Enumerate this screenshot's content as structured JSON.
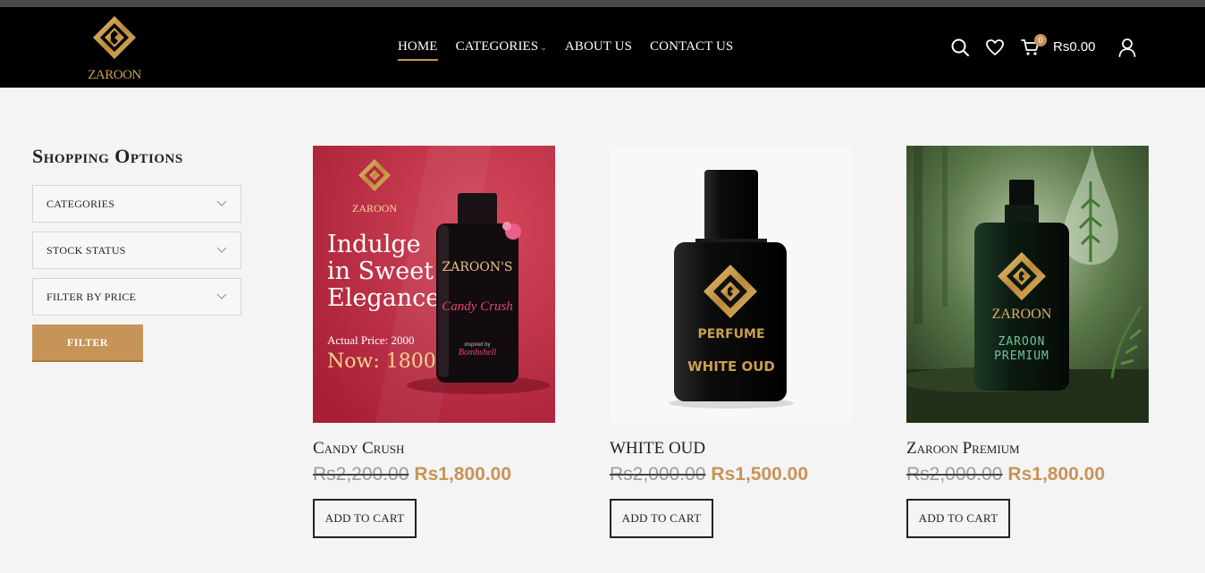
{
  "header": {
    "logo_text": "ZAROON",
    "nav": [
      {
        "label": "HOME"
      },
      {
        "label": "CATEGORIES"
      },
      {
        "label": "ABOUT US"
      },
      {
        "label": "CONTACT US"
      }
    ],
    "cart_count": "0",
    "cart_total": "Rs0.00",
    "icons": [
      "search-icon",
      "heart-icon",
      "cart-icon",
      "user-icon"
    ]
  },
  "sidebar": {
    "title": "Shopping Options",
    "filters": [
      {
        "label": "CATEGORIES"
      },
      {
        "label": "STOCK STATUS"
      },
      {
        "label": "FILTER BY PRICE"
      }
    ],
    "filter_button": "FILTER"
  },
  "products": [
    {
      "name": "Candy Crush",
      "old_price": "Rs2,200.00",
      "new_price": "Rs1,800.00",
      "button": "ADD TO CART",
      "image": {
        "brand": "ZAROON",
        "headline": [
          "Indulge",
          "in Sweet",
          "Elegance"
        ],
        "actual_price": "Actual Price: 2000",
        "now_price": "Now: 1800",
        "bottle_brand": "ZAROON'S",
        "bottle_name": "Candy Crush",
        "bottle_inspired": "inspired by",
        "bottle_sub": "Bombshell"
      }
    },
    {
      "name": "WHITE OUD",
      "old_price": "Rs2,000.00",
      "new_price": "Rs1,500.00",
      "button": "ADD TO CART",
      "image": {
        "label1": "PERFUME",
        "label2": "WHITE OUD"
      }
    },
    {
      "name": "Zaroon Premium",
      "old_price": "Rs2,000.00",
      "new_price": "Rs1,800.00",
      "button": "ADD TO CART",
      "image": {
        "brand": "ZAROON",
        "label1": "ZAROON",
        "label2": "PREMIUM"
      }
    }
  ],
  "colors": {
    "accent": "#c79458",
    "header_bg": "#000000",
    "page_bg": "#f4f4f4",
    "gold": "#c9a04d"
  }
}
